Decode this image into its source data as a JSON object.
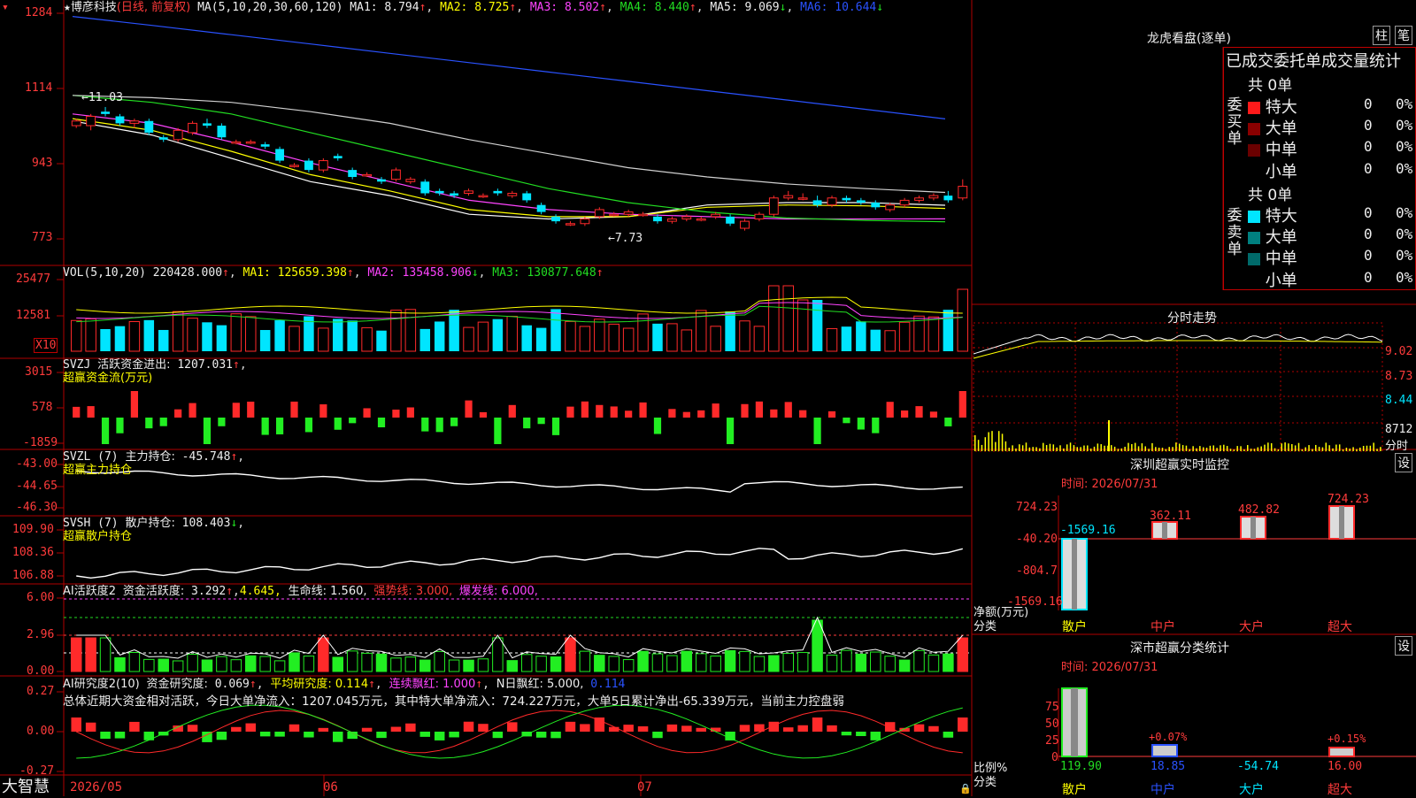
{
  "stock": {
    "name": "博彦科技",
    "mode": "(日线, 前复权)",
    "star": "★"
  },
  "colors": {
    "up": "#ff2a2a",
    "down": "#00e5ff",
    "ma1": "#ffffff",
    "ma2": "#ffff00",
    "ma3": "#ff44ff",
    "ma4": "#22dd22",
    "ma5": "#d0d0d0",
    "ma6": "#2a52ff",
    "grid": "#b00000"
  },
  "kline": {
    "header": {
      "params": "MA(5,10,20,30,60,120)",
      "ma1": "MA1: 8.794",
      "ma2": "MA2: 8.725",
      "ma3": "MA3: 8.502",
      "ma4": "MA4: 8.440",
      "ma5": "MA5: 9.069",
      "ma6": "MA6: 10.644"
    },
    "y_labels": [
      "1284",
      "1114",
      "943",
      "773"
    ],
    "high_note": "←11.03",
    "low_note": "←7.73"
  },
  "vol": {
    "header": {
      "params": "VOL(5,10,20)",
      "val": "220428.000",
      "ma1": "MA1: 125659.398",
      "ma2": "MA2: 135458.906",
      "ma3": "MA3: 130877.648"
    },
    "y_labels": [
      "25477",
      "12581"
    ],
    "unit": "X10"
  },
  "svzj": {
    "header": {
      "name": "SVZJ",
      "label": "活跃资金进出:",
      "val": "1207.031",
      "sub": "超赢资金流(万元)"
    },
    "y_labels": [
      "3015",
      "578",
      "-1859"
    ]
  },
  "svzl": {
    "header": {
      "name": "SVZL (7)",
      "label": "主力持仓:",
      "val": "-45.748",
      "sub": "超赢主力持仓"
    },
    "y_labels": [
      "-43.00",
      "-44.65",
      "-46.30"
    ]
  },
  "svsh": {
    "header": {
      "name": "SVSH (7)",
      "label": "散户持仓:",
      "val": "108.403",
      "sub": "超赢散户持仓"
    },
    "y_labels": [
      "109.90",
      "108.36",
      "106.88"
    ]
  },
  "ai1": {
    "header": {
      "name": "AI活跃度2",
      "label": "资金活跃度:",
      "val": "3.292",
      "v2": "4.645,",
      "life": "生命线: 1.560,",
      "strong": "强势线: 3.000,",
      "burst": "爆发线: 6.000,"
    },
    "y_labels": [
      "6.00",
      "2.96",
      "0.00"
    ]
  },
  "ai2": {
    "header": {
      "name": "AI研究度2(10)",
      "label": "资金研究度:",
      "val": "0.069",
      "avg": "平均研究度: 0.114",
      "streak": "连续飘红: 1.000",
      "nday": "N日飘红: 5.000,",
      "last": "0.114"
    },
    "note": "总体近期大资金相对活跃，今日大单净流入：1207.045万元，其中特大单净流入：724.227万元，大单5日累计净出-65.339万元，当前主力控盘弱",
    "y_labels": [
      "0.27",
      "0.00",
      "-0.27"
    ]
  },
  "xaxis": {
    "brand": "大智慧",
    "labels": [
      "2026/05",
      "06",
      "07"
    ]
  },
  "right": {
    "lhb_title": "龙虎看盘(逐单)",
    "tab1": "柱",
    "tab2": "笔",
    "stat_title": "已成交委托单成交量统计",
    "buy": {
      "vlabel": "委买单",
      "total": "共 0单",
      "rows": [
        {
          "name": "特大",
          "n": "0",
          "p": "0%",
          "c": "#ff1a1a"
        },
        {
          "name": "大单",
          "n": "0",
          "p": "0%",
          "c": "#8a0000"
        },
        {
          "name": "中单",
          "n": "0",
          "p": "0%",
          "c": "#6a0000"
        },
        {
          "name": "小单",
          "n": "0",
          "p": "0%",
          "c": "#000000"
        }
      ]
    },
    "sell": {
      "vlabel": "委卖单",
      "total": "共 0单",
      "rows": [
        {
          "name": "特大",
          "n": "0",
          "p": "0%",
          "c": "#00e5ff"
        },
        {
          "name": "大单",
          "n": "0",
          "p": "0%",
          "c": "#008080"
        },
        {
          "name": "中单",
          "n": "0",
          "p": "0%",
          "c": "#006a6a"
        },
        {
          "name": "小单",
          "n": "0",
          "p": "0%",
          "c": "#000000"
        }
      ]
    },
    "fenshi": {
      "title": "分时走势",
      "y_labels": [
        "9.02",
        "8.73",
        "8.44",
        "8712",
        "分时"
      ]
    },
    "sz_mon": {
      "title": "深圳超赢实时监控",
      "set": "设",
      "time": "时间: 2026/07/31",
      "y_labels": [
        "724.23",
        "-40.20",
        "-804.7",
        "-1569.16"
      ],
      "values": [
        "-1569.16",
        "362.11",
        "482.82",
        "724.23"
      ],
      "side1": "净额(万元)",
      "side2": "分类",
      "cats": [
        "散户",
        "中户",
        "大户",
        "超大"
      ]
    },
    "sz_cls": {
      "title": "深市超赢分类统计",
      "set": "设",
      "time": "时间: 2026/07/31",
      "y_labels": [
        "75",
        "50",
        "25",
        "0"
      ],
      "notes": [
        "+0.07%",
        "+0.15%"
      ],
      "values": [
        "119.90",
        "18.85",
        "-54.74",
        "16.00"
      ],
      "side1": "比例%",
      "side2": "分类",
      "cats": [
        "散户",
        "中户",
        "大户",
        "超大"
      ]
    }
  },
  "chart_data": {
    "type": "candlestick",
    "title": "博彦科技 (日线, 前复权)",
    "xlabel": "",
    "ylabel": "",
    "date_labels": [
      "2026/05",
      "06",
      "07"
    ],
    "ylim": [
      7.73,
      12.84
    ],
    "high": 11.03,
    "low": 7.73,
    "candles": [
      [
        10.5,
        10.6,
        10.45,
        10.65
      ],
      [
        10.5,
        10.7,
        10.4,
        10.75
      ],
      [
        10.8,
        10.75,
        10.7,
        10.9
      ],
      [
        10.7,
        10.55,
        10.5,
        10.75
      ],
      [
        10.55,
        10.6,
        10.45,
        10.65
      ],
      [
        10.6,
        10.35,
        10.3,
        10.65
      ],
      [
        10.25,
        10.2,
        10.15,
        10.3
      ],
      [
        10.2,
        10.4,
        10.15,
        10.45
      ],
      [
        10.35,
        10.55,
        10.3,
        10.6
      ],
      [
        10.55,
        10.5,
        10.45,
        10.65
      ],
      [
        10.5,
        10.25,
        10.2,
        10.55
      ],
      [
        10.15,
        10.15,
        10.1,
        10.2
      ],
      [
        10.15,
        10.15,
        10.1,
        10.2
      ],
      [
        10.1,
        10.05,
        10.0,
        10.15
      ],
      [
        10.0,
        9.75,
        9.7,
        10.05
      ],
      [
        9.65,
        9.65,
        9.6,
        9.7
      ],
      [
        9.75,
        9.55,
        9.5,
        9.8
      ],
      [
        9.55,
        9.75,
        9.5,
        9.8
      ],
      [
        9.85,
        9.8,
        9.75,
        9.9
      ],
      [
        9.55,
        9.4,
        9.35,
        9.6
      ],
      [
        9.45,
        9.45,
        9.4,
        9.5
      ],
      [
        9.35,
        9.3,
        9.25,
        9.4
      ],
      [
        9.35,
        9.55,
        9.3,
        9.6
      ],
      [
        9.3,
        9.35,
        9.25,
        9.4
      ],
      [
        9.3,
        9.05,
        9.0,
        9.35
      ],
      [
        9.1,
        9.05,
        9.0,
        9.15
      ],
      [
        9.05,
        9.0,
        8.95,
        9.1
      ],
      [
        9.05,
        9.1,
        9.0,
        9.15
      ],
      [
        9.0,
        9.0,
        8.95,
        9.05
      ],
      [
        9.1,
        9.05,
        9.0,
        9.15
      ],
      [
        9.0,
        9.05,
        8.95,
        9.1
      ],
      [
        9.05,
        8.9,
        8.85,
        9.1
      ],
      [
        8.8,
        8.65,
        8.6,
        8.85
      ],
      [
        8.55,
        8.45,
        8.4,
        8.6
      ],
      [
        8.4,
        8.4,
        8.35,
        8.45
      ],
      [
        8.4,
        8.5,
        8.35,
        8.55
      ],
      [
        8.55,
        8.7,
        8.5,
        8.75
      ],
      [
        8.6,
        8.6,
        8.55,
        8.65
      ],
      [
        8.6,
        8.65,
        8.55,
        8.7
      ],
      [
        8.6,
        8.6,
        8.55,
        8.65
      ],
      [
        8.55,
        8.45,
        8.4,
        8.6
      ],
      [
        8.45,
        8.5,
        8.4,
        8.55
      ],
      [
        8.5,
        8.55,
        8.45,
        8.6
      ],
      [
        8.5,
        8.5,
        8.45,
        8.55
      ],
      [
        8.55,
        8.6,
        8.5,
        8.65
      ],
      [
        8.55,
        8.4,
        8.35,
        8.6
      ],
      [
        8.3,
        8.45,
        8.25,
        8.5
      ],
      [
        8.5,
        8.6,
        8.45,
        8.65
      ],
      [
        8.6,
        8.95,
        8.55,
        9.0
      ],
      [
        8.95,
        9.0,
        8.9,
        9.1
      ],
      [
        8.95,
        8.95,
        8.9,
        9.05
      ],
      [
        8.9,
        8.8,
        8.75,
        9.0
      ],
      [
        8.8,
        8.95,
        8.75,
        9.0
      ],
      [
        8.95,
        8.9,
        8.85,
        9.0
      ],
      [
        8.9,
        8.85,
        8.8,
        8.95
      ],
      [
        8.85,
        8.75,
        8.7,
        8.9
      ],
      [
        8.7,
        8.8,
        8.65,
        8.85
      ],
      [
        8.8,
        8.9,
        8.75,
        8.95
      ],
      [
        8.9,
        8.95,
        8.85,
        9.0
      ],
      [
        8.95,
        9.0,
        8.9,
        9.05
      ],
      [
        9.0,
        8.9,
        8.85,
        9.1
      ],
      [
        8.95,
        9.2,
        8.9,
        9.35
      ]
    ],
    "ma_series": [
      {
        "name": "MA1",
        "values": [
          10.6,
          10.3,
          9.8,
          9.3,
          9.0,
          8.6,
          8.5,
          8.55,
          8.8,
          8.85,
          8.85,
          8.794
        ]
      },
      {
        "name": "MA2",
        "values": [
          10.65,
          10.4,
          9.95,
          9.45,
          9.1,
          8.7,
          8.55,
          8.55,
          8.75,
          8.8,
          8.78,
          8.725
        ]
      },
      {
        "name": "MA3",
        "values": [
          10.75,
          10.55,
          10.15,
          9.7,
          9.3,
          8.9,
          8.7,
          8.6,
          8.55,
          8.5,
          8.5,
          8.502
        ]
      },
      {
        "name": "MA4",
        "values": [
          11.15,
          11.0,
          10.75,
          10.35,
          9.95,
          9.55,
          9.15,
          8.85,
          8.65,
          8.52,
          8.47,
          8.44
        ]
      },
      {
        "name": "MA5",
        "values": [
          11.15,
          11.1,
          11.0,
          10.8,
          10.55,
          10.2,
          9.9,
          9.6,
          9.4,
          9.25,
          9.15,
          9.069
        ]
      },
      {
        "name": "MA6",
        "values": [
          12.84,
          12.65,
          12.45,
          12.25,
          12.05,
          11.85,
          11.65,
          11.45,
          11.25,
          11.05,
          10.85,
          10.644
        ]
      }
    ]
  }
}
